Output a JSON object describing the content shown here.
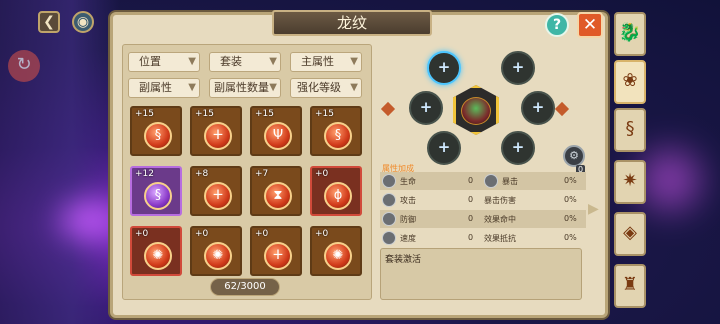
{
  "title": "龙纹",
  "count": "62/3000",
  "filters": [
    "位置",
    "套装",
    "主属性",
    "副属性",
    "副属性数量",
    "强化等级"
  ],
  "slots": [
    {
      "plus": "+15",
      "glyph": "§",
      "type": "normal"
    },
    {
      "plus": "+15",
      "glyph": "ⵜ",
      "type": "normal"
    },
    {
      "plus": "+15",
      "glyph": "Ψ",
      "type": "normal"
    },
    {
      "plus": "+15",
      "glyph": "§",
      "type": "normal"
    },
    {
      "plus": "+12",
      "glyph": "§",
      "type": "sel"
    },
    {
      "plus": "+8",
      "glyph": "ⵜ",
      "type": "normal"
    },
    {
      "plus": "+7",
      "glyph": "⧗",
      "type": "normal"
    },
    {
      "plus": "+0",
      "glyph": "ϕ",
      "type": "red"
    },
    {
      "plus": "+0",
      "glyph": "✺",
      "type": "red"
    },
    {
      "plus": "+0",
      "glyph": "✺",
      "type": "normal"
    },
    {
      "plus": "+0",
      "glyph": "ⵜ",
      "type": "normal"
    },
    {
      "plus": "+0",
      "glyph": "✺",
      "type": "normal"
    }
  ],
  "attr_header": "属性加成",
  "attrs": [
    {
      "name": "生命",
      "val": "0",
      "name2": "暴击",
      "val2": "0%"
    },
    {
      "name": "攻击",
      "val": "0",
      "name2": "暴击伤害",
      "val2": "0%"
    },
    {
      "name": "防御",
      "val": "0",
      "name2": "效果命中",
      "val2": "0%"
    },
    {
      "name": "速度",
      "val": "0",
      "name2": "效果抵抗",
      "val2": "0%"
    }
  ],
  "set_label": "套装激活",
  "coin_value": "0",
  "tabs": [
    "dragon-head-icon",
    "lotus-icon",
    "dragon-icon",
    "star-badge-icon",
    "gem-icon",
    "armor-icon"
  ],
  "colors": {
    "accent": "#e05a28",
    "panel": "#e7dbbf",
    "gem": "#d13a1a"
  }
}
